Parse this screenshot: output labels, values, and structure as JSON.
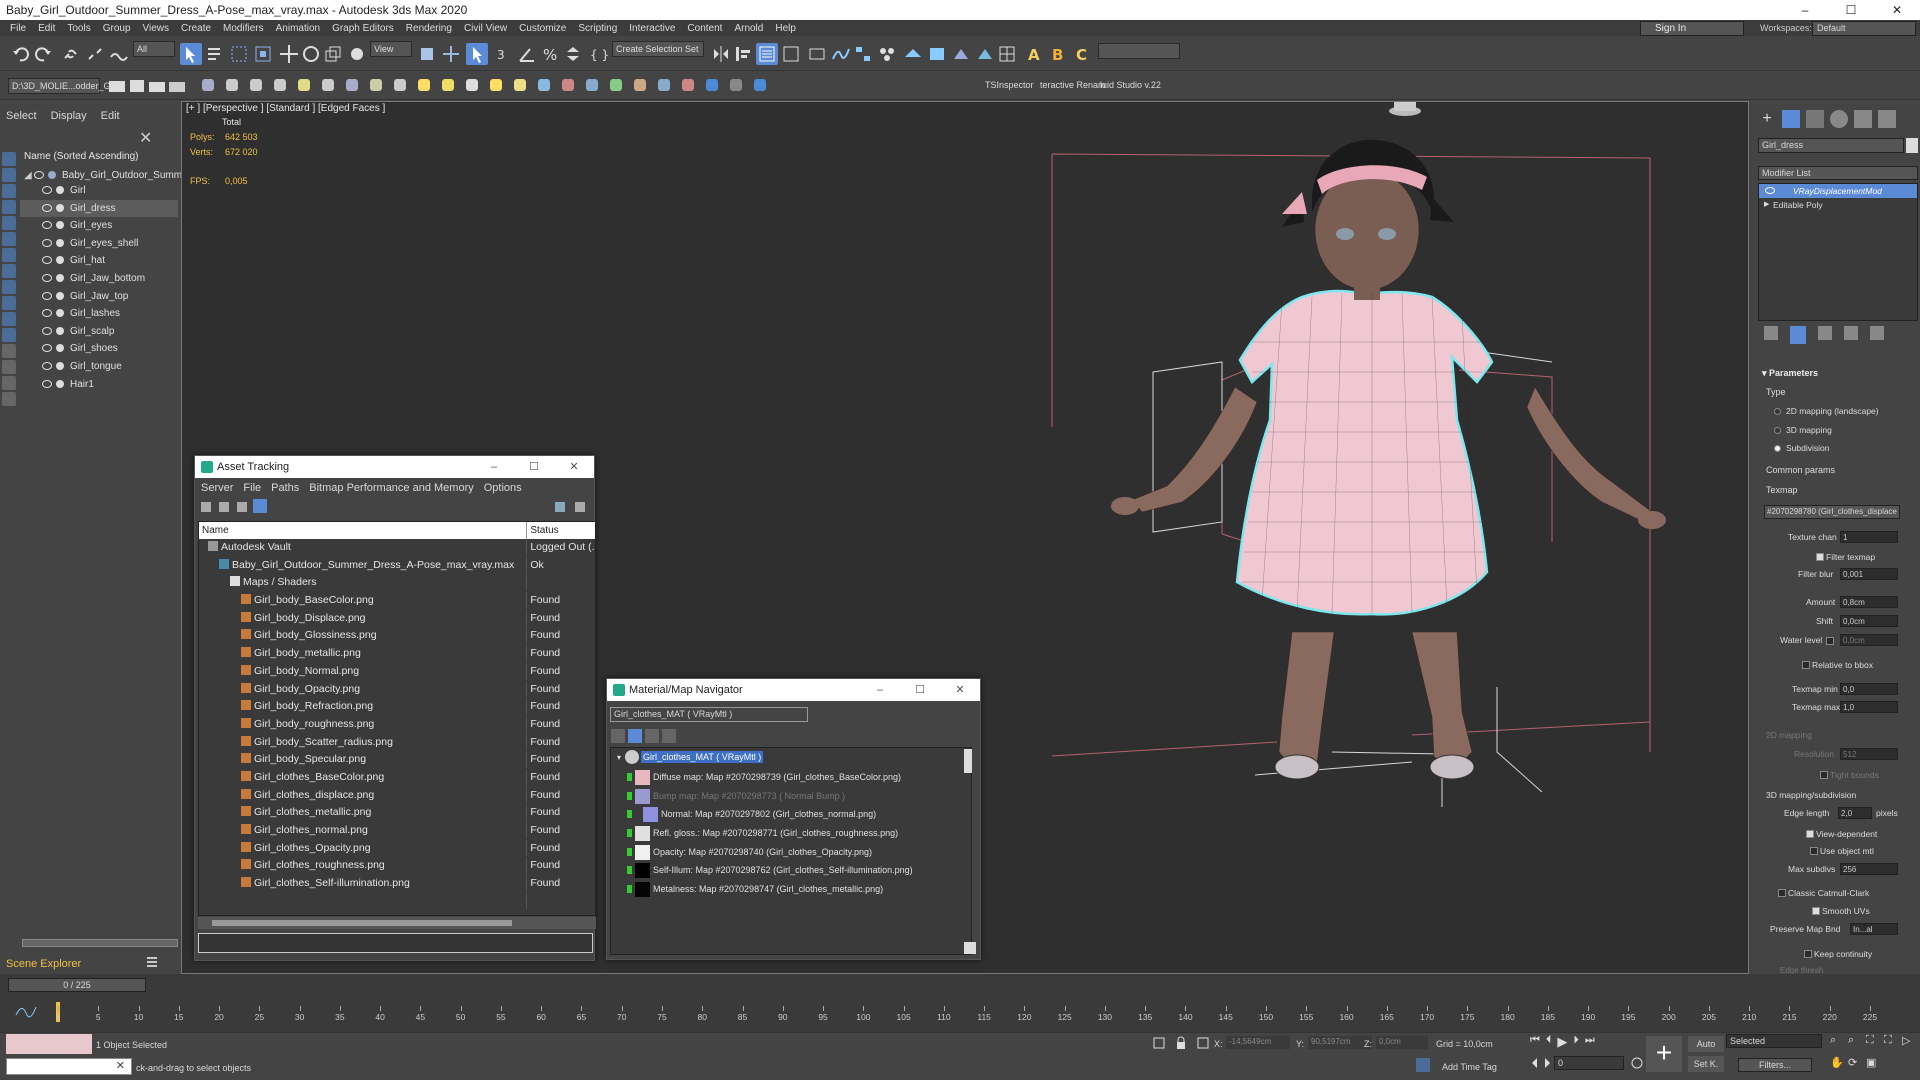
{
  "app": {
    "title": "Baby_Girl_Outdoor_Summer_Dress_A-Pose_max_vray.max - Autodesk 3ds Max 2020",
    "window_buttons": [
      "–",
      "☐",
      "✕"
    ],
    "menus": [
      "File",
      "Edit",
      "Tools",
      "Group",
      "Views",
      "Create",
      "Modifiers",
      "Animation",
      "Graph Editors",
      "Rendering",
      "Civil View",
      "Customize",
      "Scripting",
      "Interactive",
      "Content",
      "Arnold",
      "Help"
    ],
    "sign_in": "Sign In",
    "workspaces_label": "Workspaces:",
    "workspaces_value": "Default"
  },
  "toolbar": {
    "filter_all": "All",
    "view_dropdown": "View",
    "create_selection_set": "Create Selection Set",
    "path_label": "D:\\3D_MOLIE...odder_Gi",
    "ts_inspector": "TSInspector",
    "interactive_rename": "teractive Renam",
    "fluid_studio": "luid Studio v.22"
  },
  "scene_explorer": {
    "tabs": [
      "Select",
      "Display",
      "Edit"
    ],
    "header": "Name (Sorted Ascending)",
    "root": "Baby_Girl_Outdoor_Summe",
    "items": [
      "Girl",
      "Girl_dress",
      "Girl_eyes",
      "Girl_eyes_shell",
      "Girl_hat",
      "Girl_Jaw_bottom",
      "Girl_Jaw_top",
      "Girl_lashes",
      "Girl_scalp",
      "Girl_shoes",
      "Girl_tongue",
      "Hair1"
    ],
    "selected_index": 1,
    "footer": "Scene Explorer"
  },
  "viewport": {
    "label": "[+ ] [Perspective ] [Standard ] [Edged Faces ]",
    "total_label": "Total",
    "polys_label": "Polys:",
    "polys_value": "642 503",
    "verts_label": "Verts:",
    "verts_value": "672 020",
    "fps_label": "FPS:",
    "fps_value": "0,005"
  },
  "asset_tracking": {
    "title": "Asset Tracking",
    "menus": [
      "Server",
      "File",
      "Paths",
      "Bitmap Performance and Memory",
      "Options"
    ],
    "col_name": "Name",
    "col_status": "Status",
    "rows": [
      {
        "name": "Autodesk Vault",
        "status": "Logged Out (...",
        "indent": 1
      },
      {
        "name": "Baby_Girl_Outdoor_Summer_Dress_A-Pose_max_vray.max",
        "status": "Ok",
        "indent": 2
      },
      {
        "name": "Maps / Shaders",
        "status": "",
        "indent": 3
      },
      {
        "name": "Girl_body_BaseColor.png",
        "status": "Found",
        "indent": 4
      },
      {
        "name": "Girl_body_Displace.png",
        "status": "Found",
        "indent": 4
      },
      {
        "name": "Girl_body_Glossiness.png",
        "status": "Found",
        "indent": 4
      },
      {
        "name": "Girl_body_metallic.png",
        "status": "Found",
        "indent": 4
      },
      {
        "name": "Girl_body_Normal.png",
        "status": "Found",
        "indent": 4
      },
      {
        "name": "Girl_body_Opacity.png",
        "status": "Found",
        "indent": 4
      },
      {
        "name": "Girl_body_Refraction.png",
        "status": "Found",
        "indent": 4
      },
      {
        "name": "Girl_body_roughness.png",
        "status": "Found",
        "indent": 4
      },
      {
        "name": "Girl_body_Scatter_radius.png",
        "status": "Found",
        "indent": 4
      },
      {
        "name": "Girl_body_Specular.png",
        "status": "Found",
        "indent": 4
      },
      {
        "name": "Girl_clothes_BaseColor.png",
        "status": "Found",
        "indent": 4
      },
      {
        "name": "Girl_clothes_displace.png",
        "status": "Found",
        "indent": 4
      },
      {
        "name": "Girl_clothes_metallic.png",
        "status": "Found",
        "indent": 4
      },
      {
        "name": "Girl_clothes_normal.png",
        "status": "Found",
        "indent": 4
      },
      {
        "name": "Girl_clothes_Opacity.png",
        "status": "Found",
        "indent": 4
      },
      {
        "name": "Girl_clothes_roughness.png",
        "status": "Found",
        "indent": 4
      },
      {
        "name": "Girl_clothes_Self-illumination.png",
        "status": "Found",
        "indent": 4
      }
    ]
  },
  "material_navigator": {
    "title": "Material/Map Navigator",
    "current": "Girl_clothes_MAT  ( VRayMtl )",
    "root": "Girl_clothes_MAT  ( VRayMtl )",
    "rows": [
      {
        "text": "Diffuse map: Map #2070298739 (Girl_clothes_BaseColor.png)",
        "swatch": "#e8b8c0",
        "dim": false
      },
      {
        "text": "Bump map: Map #2070298773  ( Normal Bump )",
        "swatch": "#9a9ad0",
        "dim": true
      },
      {
        "text": "Normal: Map #2070297802 (Girl_clothes_normal.png)",
        "swatch": "#9090e0",
        "dim": false
      },
      {
        "text": "Refl. gloss.: Map #2070298771 (Girl_clothes_roughness.png)",
        "swatch": "#e0e0e0",
        "dim": false
      },
      {
        "text": "Opacity: Map #2070298740 (Girl_clothes_Opacity.png)",
        "swatch": "#f0f0f0",
        "dim": false
      },
      {
        "text": "Self-Illum: Map #2070298762 (Girl_clothes_Self-illumination.png)",
        "swatch": "#000000",
        "dim": false
      },
      {
        "text": "Metalness: Map #2070298747 (Girl_clothes_metallic.png)",
        "swatch": "#050505",
        "dim": false
      }
    ]
  },
  "command_panel": {
    "object_name": "Girl_dress",
    "modifier_list": "Modifier List",
    "stack": [
      "VRayDisplacementMod",
      "Editable Poly"
    ],
    "parameters": "Parameters",
    "type_label": "Type",
    "types": [
      "2D mapping (landscape)",
      "3D mapping",
      "Subdivision"
    ],
    "selected_type": 2,
    "common_params": "Common params",
    "texmap_label": "Texmap",
    "texmap_value": "#2070298780 (Girl_clothes_displace",
    "texture_chan_label": "Texture chan",
    "texture_chan": "1",
    "filter_texmap": "Filter texmap",
    "filter_blur_label": "Filter blur",
    "filter_blur": "0,001",
    "amount_label": "Amount",
    "amount": "0,8cm",
    "shift_label": "Shift",
    "shift": "0,0cm",
    "water_level_label": "Water level",
    "water_level": "0,0cm",
    "relative_bbox": "Relative to bbox",
    "texmap_min_label": "Texmap min",
    "texmap_min": "0,0",
    "texmap_max_label": "Texmap max",
    "texmap_max": "1,0",
    "mapping_2d": "2D mapping",
    "resolution_label": "Resolution",
    "resolution": "512",
    "tight_bounds": "Tight bounds",
    "mapping_3d": "3D mapping/subdivision",
    "edge_length_label": "Edge length",
    "edge_length": "2,0",
    "pixels": "pixels",
    "view_dependent": "View-dependent",
    "use_object_mtl": "Use object mtl",
    "max_subdivs_label": "Max subdivs",
    "max_subdivs": "256",
    "classic_catmull": "Classic Catmull-Clark",
    "smooth_uvs": "Smooth UVs",
    "preserve_map_label": "Preserve Map Bnd",
    "preserve_map": "In...al",
    "keep_continuity": "Keep continuity",
    "edge_thresh": "Edge thresh"
  },
  "timeline": {
    "frame_counter": "0 / 225",
    "ticks": [
      "0",
      "5",
      "10",
      "15",
      "20",
      "25",
      "30",
      "35",
      "40",
      "45",
      "50",
      "55",
      "60",
      "65",
      "70",
      "75",
      "80",
      "85",
      "90",
      "95",
      "100",
      "105",
      "110",
      "115",
      "120",
      "125",
      "130",
      "135",
      "140",
      "145",
      "150",
      "155",
      "160",
      "165",
      "170",
      "175",
      "180",
      "185",
      "190",
      "195",
      "200",
      "205",
      "210",
      "215",
      "220",
      "225"
    ]
  },
  "status": {
    "selected": "1 Object Selected",
    "prompt": "ck-and-drag to select objects",
    "x_label": "X:",
    "x_value": "-14,5649cm",
    "y_label": "Y:",
    "y_value": "90,5197cm",
    "z_label": "Z:",
    "z_value": "0,0cm",
    "grid": "Grid = 10,0cm",
    "add_time_tag": "Add Time Tag",
    "auto": "Auto",
    "selected_dd": "Selected",
    "set_k": "Set K.",
    "filters": "Filters...",
    "frame_field": "0"
  },
  "colors": {
    "accent": "#5b8ad6",
    "selection_outline": "#7ee8ee",
    "stat_yellow": "#f0c040",
    "dress_pink": "#f0c8d2",
    "bbox_red": "#c86070"
  }
}
